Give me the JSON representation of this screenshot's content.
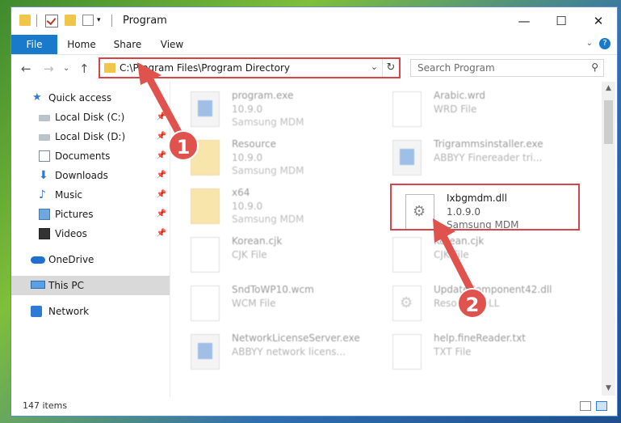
{
  "window": {
    "title": "Program",
    "controls": {
      "minimize": "—",
      "maximize": "☐",
      "close": "✕"
    }
  },
  "ribbon": {
    "tabs": [
      "File",
      "Home",
      "Share",
      "View"
    ],
    "help": "?",
    "expand": "⌄"
  },
  "nav": {
    "back": "←",
    "forward": "→",
    "recent": "⌄",
    "up": "↑",
    "address": "C:\\Program Files\\Program Directory",
    "address_dropdown": "⌄",
    "refresh": "↻",
    "search_placeholder": "Search Program",
    "search_icon": "⚲"
  },
  "sidebar": {
    "items": [
      {
        "label": "Quick access",
        "icon": "star-icon",
        "pinned": false
      },
      {
        "label": "Local Disk (C:)",
        "icon": "drive-icon",
        "pinned": true
      },
      {
        "label": "Local Disk (D:)",
        "icon": "drive-icon",
        "pinned": true
      },
      {
        "label": "Documents",
        "icon": "documents-icon",
        "pinned": true
      },
      {
        "label": "Downloads",
        "icon": "download-icon",
        "pinned": true
      },
      {
        "label": "Music",
        "icon": "music-icon",
        "pinned": true
      },
      {
        "label": "Pictures",
        "icon": "pictures-icon",
        "pinned": true
      },
      {
        "label": "Videos",
        "icon": "videos-icon",
        "pinned": true
      },
      {
        "label": "OneDrive",
        "icon": "cloud-icon",
        "pinned": false
      },
      {
        "label": "This PC",
        "icon": "computer-icon",
        "pinned": false,
        "selected": true
      },
      {
        "label": "Network",
        "icon": "network-icon",
        "pinned": false
      }
    ],
    "pin_glyph": "📌"
  },
  "files": [
    {
      "name": "program.exe",
      "version": "10.9.0",
      "company": "Samsung MDM",
      "icon": "app-icon"
    },
    {
      "name": "Arabic.wrd",
      "version": "WRD File",
      "company": "",
      "icon": "document-icon"
    },
    {
      "name": "Resource",
      "version": "10.9.0",
      "company": "Samsung MDM",
      "icon": "folder-icon"
    },
    {
      "name": "Trigrammsinstaller.exe",
      "version": "ABBYY Finereader tri...",
      "company": "",
      "icon": "app-icon"
    },
    {
      "name": "x64",
      "version": "10.9.0",
      "company": "Samsung MDM",
      "icon": "folder-icon"
    },
    {
      "name": "Ixbgmdm.dll",
      "version": "1.0.9.0",
      "company": "Samsung MDM",
      "icon": "dll-icon"
    },
    {
      "name": "Korean.cjk",
      "version": "CJK File",
      "company": "",
      "icon": "document-icon"
    },
    {
      "name": "Korean.cjk",
      "version": "CJK File",
      "company": "",
      "icon": "document-icon"
    },
    {
      "name": "SndToWP10.wcm",
      "version": "WCM File",
      "company": "",
      "icon": "document-icon"
    },
    {
      "name": "UpdateComponent42.dll",
      "version": "Resource DLL",
      "company": "",
      "icon": "dll-icon"
    },
    {
      "name": "NetworkLicenseServer.exe",
      "version": "ABBYY network licens...",
      "company": "",
      "icon": "app-icon"
    },
    {
      "name": "help.fineReader.txt",
      "version": "TXT File",
      "company": "",
      "icon": "document-icon"
    }
  ],
  "status": {
    "count": "147 items"
  },
  "annotations": {
    "step1": "1",
    "step2": "2",
    "color": "#d9444a"
  }
}
